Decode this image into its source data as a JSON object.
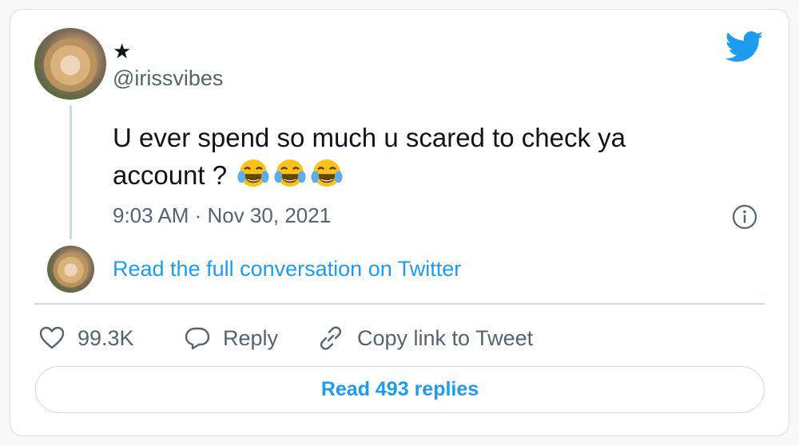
{
  "author": {
    "display_name": "★",
    "handle": "@irissvibes"
  },
  "tweet": {
    "text": "U ever spend so much u scared to check ya account ?",
    "emojis": [
      "face-with-tears-of-joy",
      "face-with-tears-of-joy",
      "face-with-tears-of-joy"
    ],
    "timestamp": "9:03 AM · Nov 30, 2021"
  },
  "conversation_link": "Read the full conversation on Twitter",
  "actions": {
    "likes": "99.3K",
    "reply": "Reply",
    "copy_link": "Copy link to Tweet"
  },
  "replies_button": "Read 493 replies",
  "icons": [
    "twitter-bird-icon",
    "info-icon",
    "heart-icon",
    "reply-bubble-icon",
    "link-icon"
  ],
  "colors": {
    "accent": "#1d9bf0",
    "text_primary": "#0f1419",
    "text_secondary": "#536471",
    "border": "#cfd9de"
  }
}
